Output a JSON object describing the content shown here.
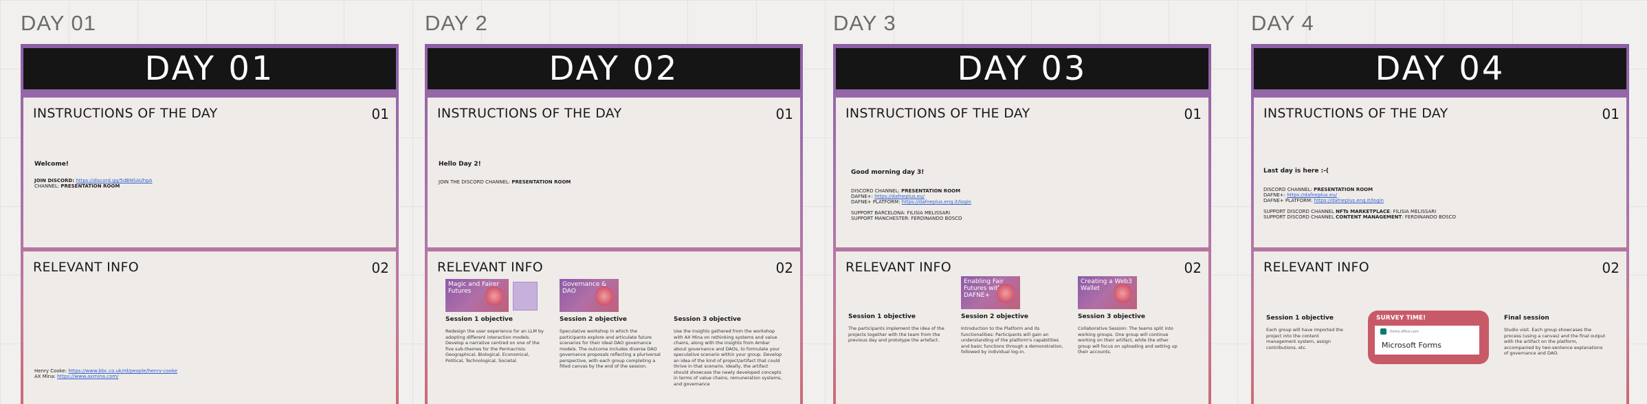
{
  "day_labels": [
    "DAY 01",
    "DAY 2",
    "DAY 3",
    "DAY 4"
  ],
  "boards": [
    {
      "header": "DAY 01",
      "instructions": {
        "title": "INSTRUCTIONS OF THE DAY",
        "num": "01",
        "welcome": "Welcome!",
        "join_label": "JOIN DISCORD: ",
        "join_link": "https://discord.gg/5dBNSAUhpA",
        "channel_label": "CHANNEL: ",
        "channel_value": "PRESENTATION ROOM"
      },
      "relevant": {
        "title": "RELEVANT INFO",
        "num": "02",
        "link1_label": "Henry Cooke: ",
        "link1": "https://www.bbc.co.uk/rd/people/henry-cooke",
        "link2_label": "AX Mina: ",
        "link2": "https://www.axmina.com/"
      }
    },
    {
      "header": "DAY 02",
      "instructions": {
        "title": "INSTRUCTIONS OF THE DAY",
        "num": "01",
        "welcome": "Hello Day 2!",
        "channel_label": "JOIN THE DISCORD CHANNEL: ",
        "channel_value": "PRESENTATION ROOM"
      },
      "relevant": {
        "title": "RELEVANT INFO",
        "num": "02",
        "thumb1": "Magic and Fairer Futures",
        "thumb2": "Governance & DAO",
        "s1_title": "Session 1 objective",
        "s1_body": "Redesign the user experience for an LLM by adopting different interaction models. Develop a narrative centred on one of the five sub-themes for the Permacrisis: Geographical, Biological, Economical, Political, Technological, Societal.",
        "s2_title": "Session 2 objective",
        "s2_body": "Speculative workshop in which the participants explore and articulate future scenarios for their ideal DAO governance models. The outcome includes diverse DAO governance proposals reflecting a pluriversal perspective, with each group completing a filled canvas by the end of the session.",
        "s3_title": "Session 3 objective",
        "s3_body": "Use the insights gathered from the workshop with AX Mina on rethinking systems and value chains, along with the insights from Ambar about governance and DAOs, to formulate your speculative scenario within your group. Develop an idea of the kind of project/artifact that could thrive in that scenario. Ideally, the artifact should showcase the newly developed concepts in terms of value chains, remuneration systems, and governance"
      }
    },
    {
      "header": "DAY 03",
      "instructions": {
        "title": "INSTRUCTIONS OF THE DAY",
        "num": "01",
        "welcome": "Good morning day 3!",
        "discord_label": "DISCORD CHANNEL: ",
        "discord_value": "PRESENTATION ROOM",
        "dafne_label": "DAFNE+: ",
        "dafne_link": "https://dafneplus.eu/",
        "platform_label": "DAFNE+ PLATFORM: ",
        "platform_link": "https://dafneplus.eng.it/login",
        "support1": "SUPPORT BARCELONA: FILISIA MELISSARI",
        "support2": "SUPPORT MANCHESTER: FERDINANDO BOSCO"
      },
      "relevant": {
        "title": "RELEVANT INFO",
        "num": "02",
        "thumb1": "Enabling Fair Futures with DAFNE+",
        "thumb2": "Creating a Web3 Wallet",
        "s1_title": "Session 1 objective",
        "s1_body": "The participants implement the idea of the projects together with the team from the previous day and prototype the artefact.",
        "s2_title": "Session 2 objective",
        "s2_body": "Introduction to the Platform and its functionalities: Participants will gain an understanding of the platform's capabilities and basic functions through a demonstration, followed by individual log-in.",
        "s3_title": "Session 3 objective",
        "s3_body": "Collaborative Session: The teams split into working groups. One group will continue working on their artifact, while the other group will focus on uploading and setting up their accounts."
      }
    },
    {
      "header": "DAY 04",
      "instructions": {
        "title": "INSTRUCTIONS OF THE DAY",
        "num": "01",
        "welcome": "Last day is here :-(",
        "discord_label": "DISCORD CHANNEL: ",
        "discord_value": "PRESENTATION ROOM",
        "dafne_label": "DAFNE+: ",
        "dafne_link": "https://dafneplus.eu/",
        "platform_label": "DAFNE+ PLATFORM: ",
        "platform_link": "https://dafneplus.eng.it/login",
        "support1_label": "SUPPORT DISCORD CHANNEL ",
        "support1_bold": "NFTs MARKETPLACE",
        "support1_rest": ": FILISIA MELISSARI",
        "support2_label": "SUPPORT DISCORD CHANNEL ",
        "support2_bold": "CONTENT MANAGEMENT",
        "support2_rest": ": FERDINANDO BOSCO"
      },
      "relevant": {
        "title": "RELEVANT INFO",
        "num": "02",
        "s1_title": "Session 1 objective",
        "s1_body": "Each group will have imported the project into the content management system, assign contributions, etc.",
        "survey_title": "SURVEY TIME!",
        "survey_site": "forms.office.com",
        "survey_name": "Microsoft Forms",
        "final_title": "Final session",
        "final_body": "Studio visit. Each group showcases the process (using a canvas) and the final output with the artifact on the platform, accompanied by two-sentence explanations of governance and DAO."
      }
    }
  ]
}
